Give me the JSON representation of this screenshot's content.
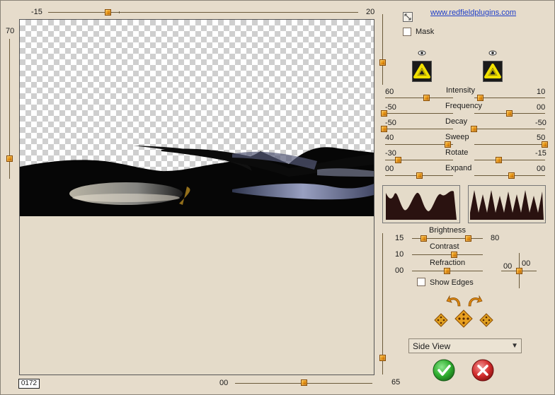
{
  "top_slider": {
    "min_label": "-15",
    "max_label": "20"
  },
  "left_slider": {
    "label": "70"
  },
  "bottom_slider": {
    "label": "00"
  },
  "right_vertical_slider": {
    "label": "65"
  },
  "frame_counter": "0172",
  "website_link": "www.redfieldplugins.com",
  "mask": {
    "label": "Mask",
    "checked": false
  },
  "params": [
    {
      "name": "Intensity",
      "left_value": "60",
      "right_value": "10"
    },
    {
      "name": "Frequency",
      "left_value": "-50",
      "right_value": "00"
    },
    {
      "name": "Decay",
      "left_value": "-50",
      "right_value": "-50"
    },
    {
      "name": "Sweep",
      "left_value": "40",
      "right_value": "50"
    },
    {
      "name": "Rotate",
      "left_value": "-30",
      "right_value": "-15"
    },
    {
      "name": "Expand",
      "left_value": "00",
      "right_value": "00"
    }
  ],
  "lighting": {
    "brightness": {
      "label": "Brightness",
      "left_value": "15",
      "right_value": "80"
    },
    "contrast": {
      "label": "Contrast",
      "value": "10"
    },
    "refraction": {
      "label": "Refraction",
      "value": "00"
    },
    "crosshair": {
      "x_value": "00",
      "y_value": "00"
    }
  },
  "show_edges": {
    "label": "Show Edges",
    "checked": false
  },
  "view_select": {
    "value": "Side View"
  },
  "colors": {
    "accent": "#e08a10",
    "ok": "#2fae2f",
    "cancel": "#d22b2b",
    "link": "#1c3cc8"
  }
}
